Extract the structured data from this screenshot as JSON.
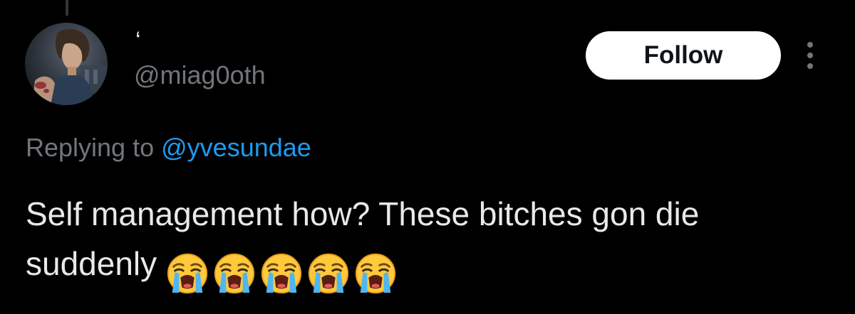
{
  "tweet": {
    "display_name": "‘",
    "handle": "@miag0oth",
    "follow_label": "Follow",
    "replying_to_prefix": "Replying to",
    "replying_to_handle": "@yvesundae",
    "text": "Self management how? These bitches gon die suddenly",
    "emojis": [
      "loudly-crying-face",
      "loudly-crying-face",
      "loudly-crying-face",
      "loudly-crying-face",
      "loudly-crying-face"
    ],
    "avatar": "avatar-image",
    "more_icon": "more-options-icon"
  },
  "colors": {
    "background": "#000000",
    "primary_text": "#e7e9ea",
    "secondary_text": "#71767b",
    "link": "#1d9bf0",
    "follow_button_bg": "#ffffff",
    "follow_button_text": "#0f1419"
  }
}
